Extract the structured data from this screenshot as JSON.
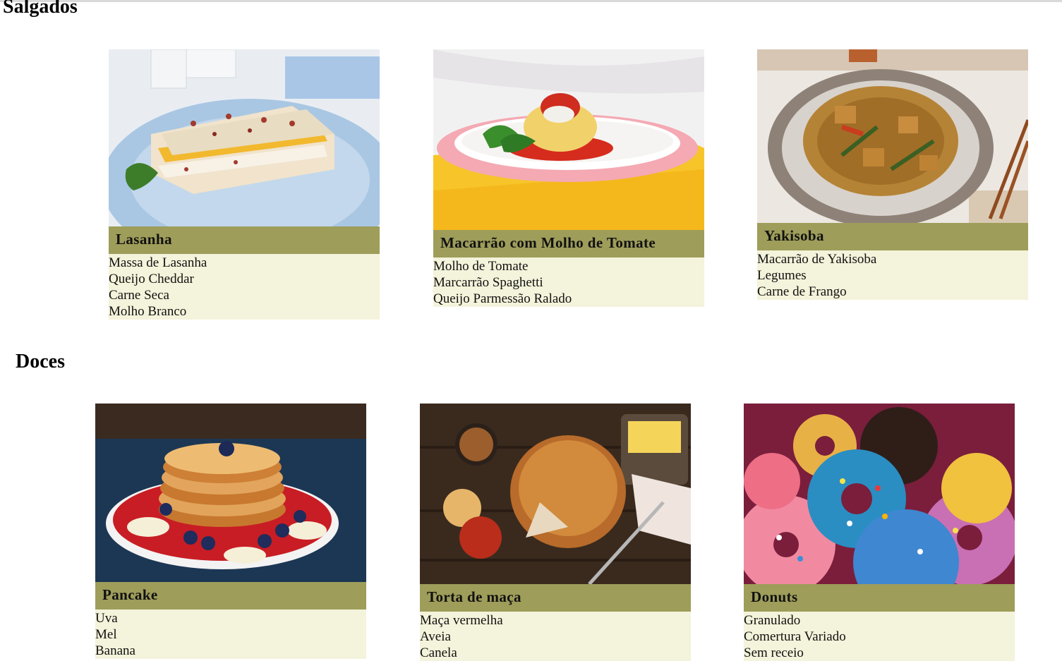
{
  "sections": {
    "salgados": {
      "title": "Salgados",
      "cards": [
        {
          "name": "Lasanha",
          "ingredients": [
            "Massa de Lasanha",
            "Queijo Cheddar",
            "Carne Seca",
            "Molho Branco"
          ]
        },
        {
          "name": "Macarrão com Molho de Tomate",
          "ingredients": [
            "Molho de Tomate",
            "Marcarrão Spaghetti",
            "Queijo Parmessão Ralado"
          ]
        },
        {
          "name": "Yakisoba",
          "ingredients": [
            "Macarrão de Yakisoba",
            "Legumes",
            "Carne de Frango"
          ]
        }
      ]
    },
    "doces": {
      "title": "Doces",
      "cards": [
        {
          "name": "Pancake",
          "ingredients": [
            "Uva",
            "Mel",
            "Banana"
          ]
        },
        {
          "name": "Torta de maça",
          "ingredients": [
            "Maça vermelha",
            "Aveia",
            "Canela"
          ]
        },
        {
          "name": "Donuts",
          "ingredients": [
            "Granulado",
            "Comertura Variado",
            "Sem receio"
          ]
        }
      ]
    }
  },
  "colors": {
    "card_title_bg": "#9e9d5a",
    "ingredients_bg": "#f4f3db"
  }
}
